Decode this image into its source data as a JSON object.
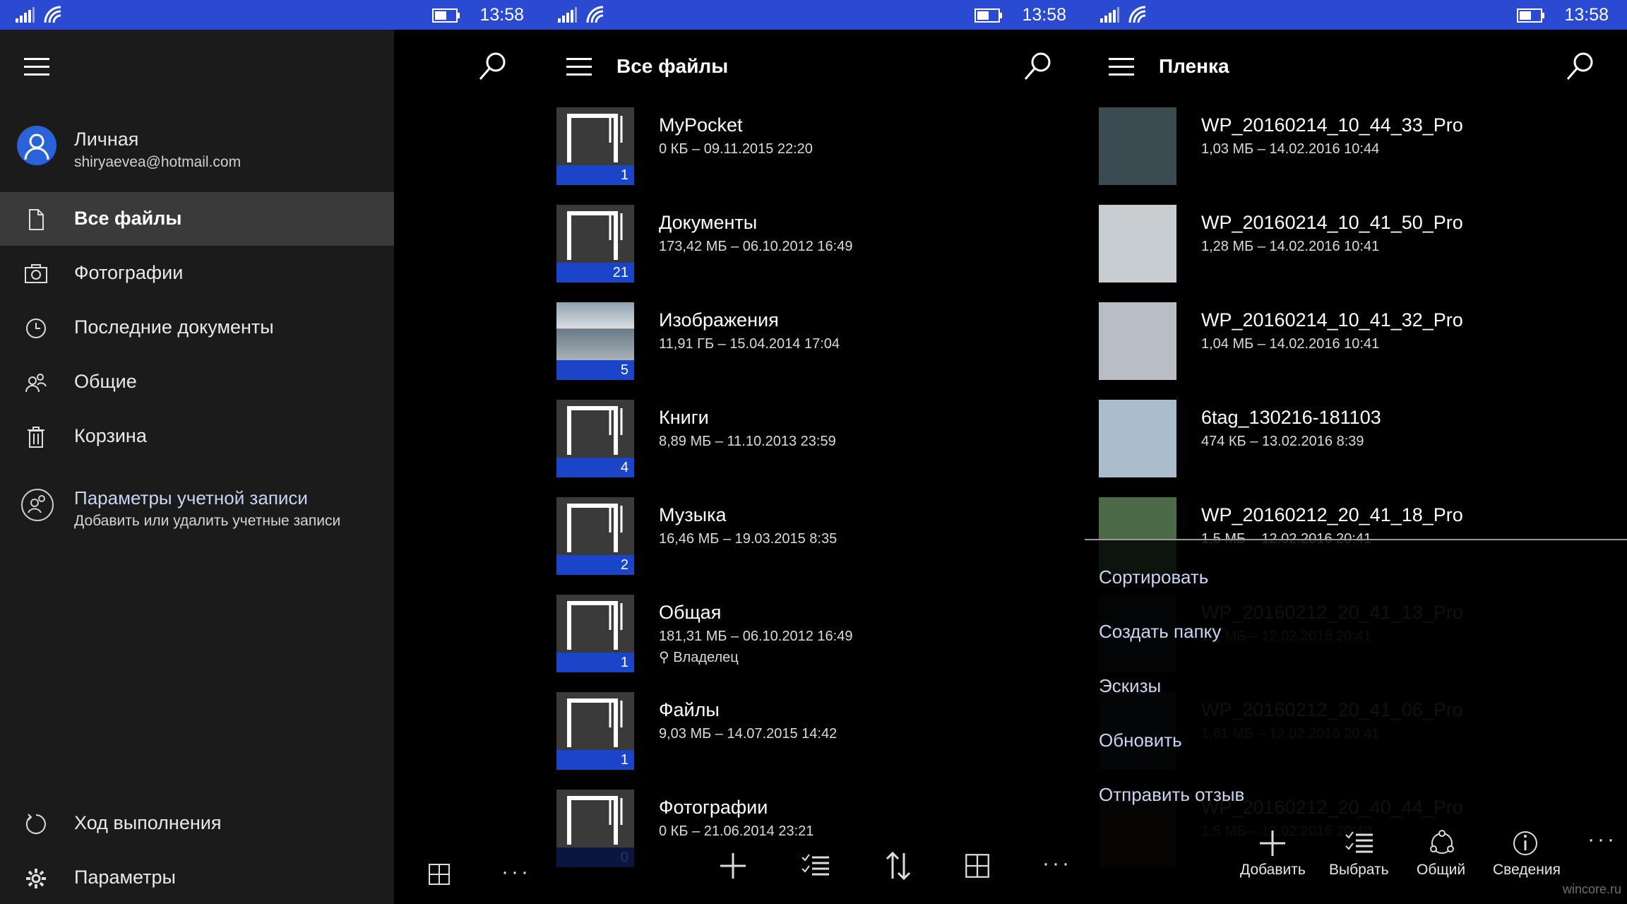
{
  "status": {
    "time": "13:58"
  },
  "panel1": {
    "account": {
      "name": "Личная",
      "email": "shiryaevea@hotmail.com"
    },
    "nav": [
      {
        "label": "Все файлы",
        "icon": "document-icon",
        "selected": true
      },
      {
        "label": "Фотографии",
        "icon": "camera-icon"
      },
      {
        "label": "Последние документы",
        "icon": "clock-icon"
      },
      {
        "label": "Общие",
        "icon": "people-icon"
      },
      {
        "label": "Корзина",
        "icon": "trash-icon"
      }
    ],
    "account_settings": {
      "title": "Параметры учетной записи",
      "subtitle": "Добавить или удалить учетные записи"
    },
    "bottom": [
      {
        "label": "Ход выполнения",
        "icon": "sync-icon"
      },
      {
        "label": "Параметры",
        "icon": "gear-icon"
      }
    ]
  },
  "panel2": {
    "title": "Все файлы",
    "files": [
      {
        "name": "MyPocket",
        "meta": "0 КБ – 09.11.2015 22:20",
        "count": "1"
      },
      {
        "name": "Документы",
        "meta": "173,42 МБ – 06.10.2012 16:49",
        "count": "21"
      },
      {
        "name": "Изображения",
        "meta": "11,91 ГБ – 15.04.2014 17:04",
        "count": "5",
        "photo": true
      },
      {
        "name": "Книги",
        "meta": "8,89 МБ – 11.10.2013 23:59",
        "count": "4"
      },
      {
        "name": "Музыка",
        "meta": "16,46 МБ – 19.03.2015 8:35",
        "count": "2"
      },
      {
        "name": "Общая",
        "meta": "181,31 МБ – 06.10.2012 16:49",
        "count": "1",
        "share": "Владелец"
      },
      {
        "name": "Файлы",
        "meta": "9,03 МБ – 14.07.2015 14:42",
        "count": "1"
      },
      {
        "name": "Фотографии",
        "meta": "0 КБ – 21.06.2014 23:21",
        "count": "0"
      }
    ]
  },
  "panel3": {
    "title": "Пленка",
    "files": [
      {
        "name": "WP_20160214_10_44_33_Pro",
        "meta": "1,03 МБ – 14.02.2016 10:44",
        "thumb": "#3b4b52"
      },
      {
        "name": "WP_20160214_10_41_50_Pro",
        "meta": "1,28 МБ – 14.02.2016 10:41",
        "thumb": "#c8cdd2"
      },
      {
        "name": "WP_20160214_10_41_32_Pro",
        "meta": "1,04 МБ – 14.02.2016 10:41",
        "thumb": "#b9bec4"
      },
      {
        "name": "6tag_130216-181103",
        "meta": "474 КБ – 13.02.2016 8:39",
        "thumb": "#a9bdcc"
      },
      {
        "name": "WP_20160212_20_41_18_Pro",
        "meta": "1,5 МБ – 12.02.2016 20:41",
        "thumb": "#4c6a48"
      },
      {
        "name": "WP_20160212_20_41_13_Pro",
        "meta": "1,2 МБ – 12.02.2016 20:41",
        "thumb": "#3a4a5a"
      },
      {
        "name": "WP_20160212_20_41_06_Pro",
        "meta": "1,61 МБ – 12.02.2016 20:41",
        "thumb": "#3f5566"
      },
      {
        "name": "WP_20160212_20_40_44_Pro",
        "meta": "1,5 МБ – 12.02.2016 20:40",
        "thumb": "#6a5a40"
      }
    ],
    "menu": [
      "Сортировать",
      "Создать папку",
      "Эскизы",
      "Обновить",
      "Отправить отзыв"
    ],
    "appbar": [
      {
        "label": "Добавить",
        "icon": "plus-icon"
      },
      {
        "label": "Выбрать",
        "icon": "select-list-icon"
      },
      {
        "label": "Общий",
        "icon": "share-icon"
      },
      {
        "label": "Сведения",
        "icon": "info-icon"
      }
    ],
    "watermark": "wincore.ru"
  }
}
